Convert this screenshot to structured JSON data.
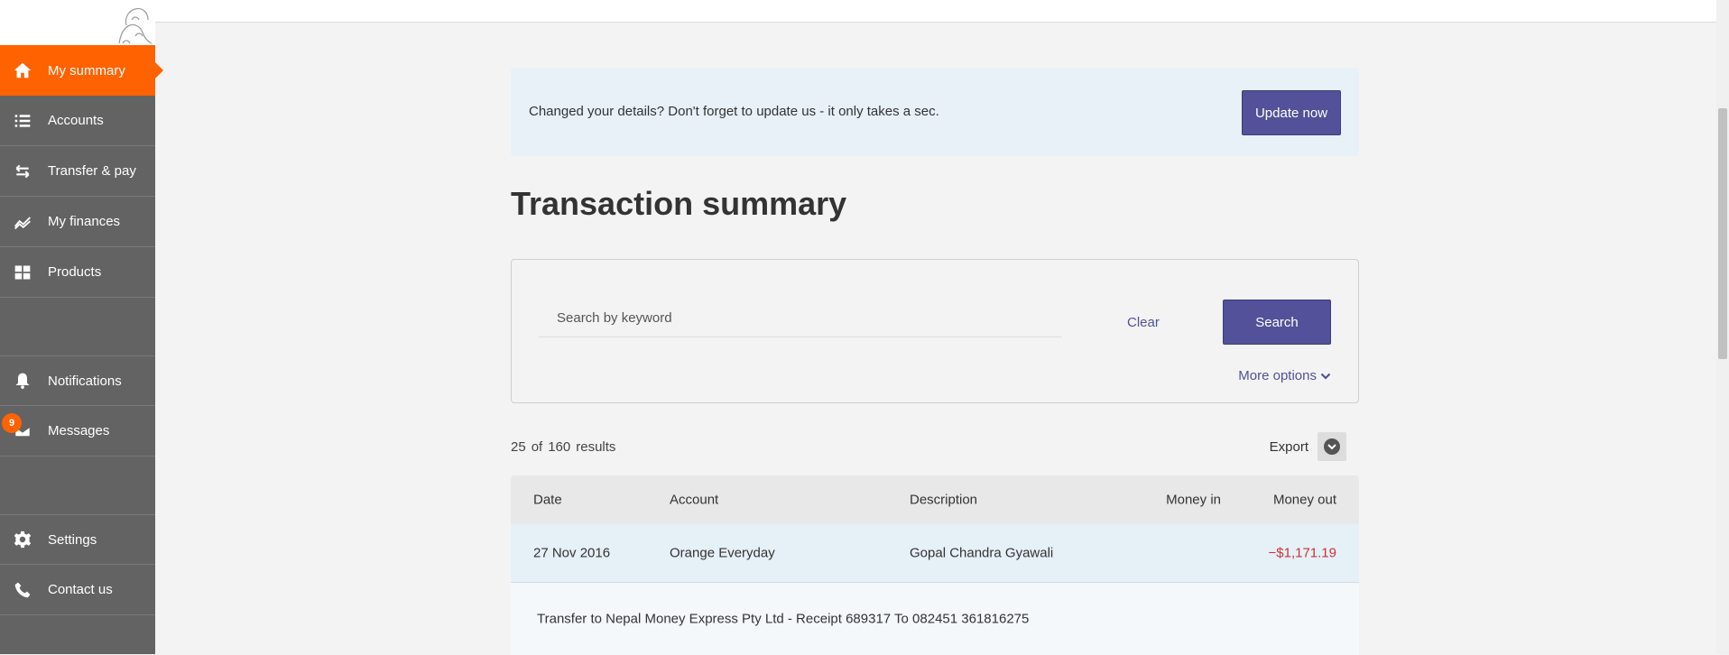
{
  "sidebar": {
    "items": [
      {
        "label": "My summary",
        "icon": "home-icon",
        "active": true
      },
      {
        "label": "Accounts",
        "icon": "list-icon"
      },
      {
        "label": "Transfer & pay",
        "icon": "transfer-icon"
      },
      {
        "label": "My finances",
        "icon": "trend-icon"
      },
      {
        "label": "Products",
        "icon": "grid-icon"
      },
      {
        "label": "Notifications",
        "icon": "bell-icon"
      },
      {
        "label": "Messages",
        "icon": "mail-icon",
        "badge": "9"
      },
      {
        "label": "Settings",
        "icon": "gear-icon"
      },
      {
        "label": "Contact us",
        "icon": "phone-icon"
      }
    ]
  },
  "banner": {
    "text": "Changed your details? Don't forget to update us - it only takes a sec.",
    "button": "Update now"
  },
  "page": {
    "title": "Transaction summary"
  },
  "search": {
    "placeholder": "Search by keyword",
    "clear": "Clear",
    "button": "Search",
    "more_options": "More options"
  },
  "results": {
    "shown": "25",
    "of": "of",
    "total": "160",
    "label": "results"
  },
  "export": {
    "label": "Export"
  },
  "table": {
    "headers": {
      "date": "Date",
      "account": "Account",
      "description": "Description",
      "money_in": "Money in",
      "money_out": "Money out"
    },
    "rows": [
      {
        "date": "27 Nov 2016",
        "account": "Orange Everyday",
        "description": "Gopal Chandra Gyawali",
        "money_in": "",
        "money_out": "−$1,171.19",
        "detail": "Transfer to Nepal Money Express Pty Ltd - Receipt 689317 To 082451 361816275"
      }
    ]
  },
  "colors": {
    "brand_orange": "#ff6200",
    "primary_purple": "#525199",
    "sidebar_gray": "#636363",
    "debit_red": "#cc3333"
  }
}
